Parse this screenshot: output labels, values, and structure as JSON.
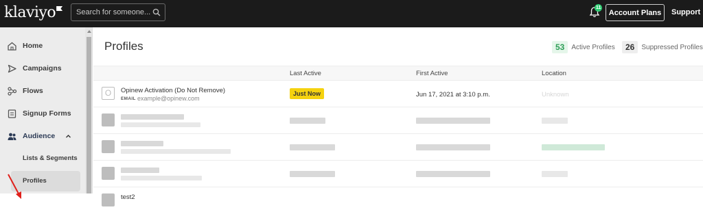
{
  "brand": {
    "logo_text": "klaviyo"
  },
  "search": {
    "placeholder": "Search for someone..."
  },
  "header": {
    "notification_count": "11",
    "account_plans_label": "Account Plans",
    "support_label": "Support"
  },
  "sidebar": {
    "items": [
      {
        "label": "Home",
        "icon": "home-icon"
      },
      {
        "label": "Campaigns",
        "icon": "send-icon"
      },
      {
        "label": "Flows",
        "icon": "flow-icon"
      },
      {
        "label": "Signup Forms",
        "icon": "form-icon"
      },
      {
        "label": "Audience",
        "icon": "users-icon"
      }
    ],
    "sub_items": [
      {
        "label": "Lists & Segments"
      },
      {
        "label": "Profiles",
        "active": true
      }
    ]
  },
  "main": {
    "title": "Profiles",
    "stats": {
      "active": {
        "value": "53",
        "label": "Active Profiles"
      },
      "suppressed": {
        "value": "26",
        "label": "Suppressed Profiles"
      }
    },
    "columns": [
      "Last Active",
      "First Active",
      "Location"
    ],
    "first_row": {
      "avatar_letter": "O",
      "name": "Opinew Activation (Do Not Remove)",
      "email_label": "EMAIL",
      "email": "example@opinew.com",
      "last_active": "Just Now",
      "first_active": "Jun 17, 2021 at 3:10 p.m.",
      "location": "Unknown"
    },
    "partial_row": {
      "name": "test2"
    }
  },
  "colors": {
    "topbar": "#1b1b1b",
    "sidebar": "#ececec",
    "badge": "#2ecc71",
    "active_stat": "#2e9e57",
    "just_now_tag": "#f5d20f",
    "annotation_arrow": "#e0201b"
  }
}
